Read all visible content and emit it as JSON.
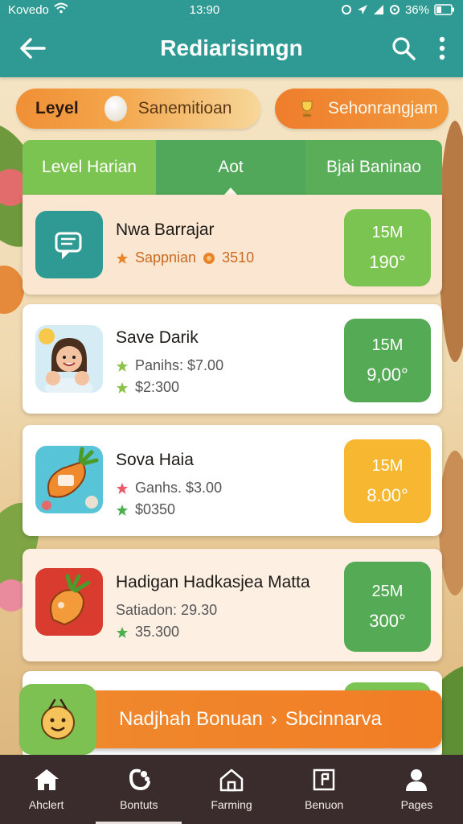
{
  "status_bar": {
    "carrier": "Kovedo",
    "time": "13:90",
    "battery": "36%"
  },
  "header": {
    "title": "Rediarisimgn",
    "back_icon": "arrow-left-icon",
    "search_icon": "search-icon",
    "menu_icon": "more-vertical-icon"
  },
  "pills": {
    "level_label": "Leyel",
    "level_name": "Sanemitioan",
    "schedule_label": "Sehonrangjam"
  },
  "tabs": [
    {
      "label": "Level Harian"
    },
    {
      "label": "Aot"
    },
    {
      "label": "Bjai Baninao"
    }
  ],
  "items": [
    {
      "name": "Nwa Barrajar",
      "line1": "Sappnian",
      "line1_value": "3510",
      "line2": "",
      "reward_top": "15M",
      "reward_bottom": "190°",
      "reward_color": "#7cc452",
      "thumb_color": "#2f9a93"
    },
    {
      "name": "Save Darik",
      "line1": "Panihs: $7.00",
      "line2": "$2:300",
      "reward_top": "15M",
      "reward_bottom": "9,00°",
      "reward_color": "#55aa55",
      "thumb_color": "#cfe7f2"
    },
    {
      "name": "Sova Haia",
      "line1": "Ganhs. $3.00",
      "line2": "$0350",
      "reward_top": "15M",
      "reward_bottom": "8.00°",
      "reward_color": "#f7b731",
      "thumb_color": "#57c4d8"
    },
    {
      "name": "Hadigan Hadkasjea Matta",
      "line1": "Satiadon: 29.30",
      "line2": "35.300",
      "reward_top": "25M",
      "reward_bottom": "300°",
      "reward_color": "#55aa55",
      "thumb_color": "#d93b2f"
    }
  ],
  "banner": {
    "text": "Nadjhah Bonuan",
    "arrow": "›",
    "target": "Sbcinnarva"
  },
  "bottom_nav": [
    {
      "label": "Ahclert",
      "icon": "home-icon"
    },
    {
      "label": "Bontuts",
      "icon": "gift-icon"
    },
    {
      "label": "Farming",
      "icon": "barn-icon"
    },
    {
      "label": "Benuon",
      "icon": "document-icon"
    },
    {
      "label": "Pages",
      "icon": "user-icon"
    }
  ],
  "colors": {
    "primary": "#2f9a93",
    "accent_orange": "#f08a2e",
    "accent_green": "#7cc452",
    "nav_bg": "#3a2c2c"
  }
}
